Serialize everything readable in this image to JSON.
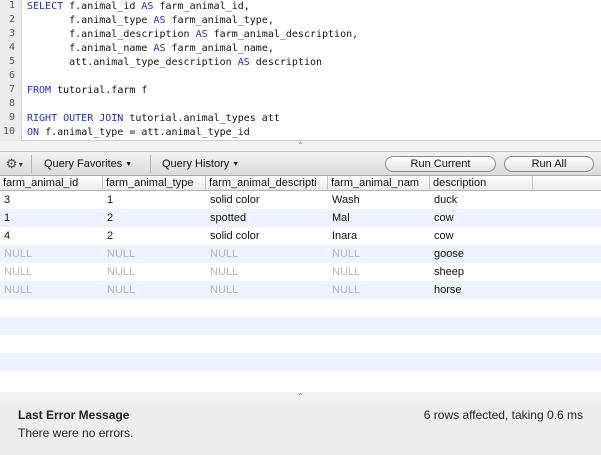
{
  "editor": {
    "lines": [
      {
        "number": "1",
        "segments": [
          {
            "t": "SELECT",
            "kw": true
          },
          {
            "t": " f.animal_id ",
            "kw": false
          },
          {
            "t": "AS",
            "kw": true
          },
          {
            "t": " farm_animal_id,",
            "kw": false
          }
        ]
      },
      {
        "number": "2",
        "segments": [
          {
            "t": "       f.animal_type ",
            "kw": false
          },
          {
            "t": "AS",
            "kw": true
          },
          {
            "t": " farm_animal_type,",
            "kw": false
          }
        ]
      },
      {
        "number": "3",
        "segments": [
          {
            "t": "       f.animal_description ",
            "kw": false
          },
          {
            "t": "AS",
            "kw": true
          },
          {
            "t": " farm_animal_description,",
            "kw": false
          }
        ]
      },
      {
        "number": "4",
        "segments": [
          {
            "t": "       f.animal_name ",
            "kw": false
          },
          {
            "t": "AS",
            "kw": true
          },
          {
            "t": " farm_animal_name,",
            "kw": false
          }
        ]
      },
      {
        "number": "5",
        "segments": [
          {
            "t": "       att.animal_type_description ",
            "kw": false
          },
          {
            "t": "AS",
            "kw": true
          },
          {
            "t": " description",
            "kw": false
          }
        ]
      },
      {
        "number": "6",
        "segments": []
      },
      {
        "number": "7",
        "segments": [
          {
            "t": "FROM",
            "kw": true
          },
          {
            "t": " tutorial.farm f",
            "kw": false
          }
        ]
      },
      {
        "number": "8",
        "segments": []
      },
      {
        "number": "9",
        "segments": [
          {
            "t": "RIGHT OUTER JOIN",
            "kw": true
          },
          {
            "t": " tutorial.animal_types att",
            "kw": false
          }
        ]
      },
      {
        "number": "10",
        "segments": [
          {
            "t": "ON",
            "kw": true
          },
          {
            "t": " f.animal_type = att.animal_type_id",
            "kw": false
          }
        ]
      }
    ]
  },
  "toolbar": {
    "gear_glyph": "⚙",
    "favorites_label": "Query Favorites",
    "history_label": "Query History",
    "run_current_label": "Run Current",
    "run_all_label": "Run All"
  },
  "grip_glyph": "⌃",
  "results": {
    "columns": [
      "farm_animal_id",
      "farm_animal_type",
      "farm_animal_descripti",
      "farm_animal_nam",
      "description"
    ],
    "rows": [
      [
        "3",
        "1",
        "solid color",
        "Wash",
        "duck"
      ],
      [
        "1",
        "2",
        "spotted",
        "Mal",
        "cow"
      ],
      [
        "4",
        "2",
        "solid color",
        "Inara",
        "cow"
      ],
      [
        "NULL",
        "NULL",
        "NULL",
        "NULL",
        "goose"
      ],
      [
        "NULL",
        "NULL",
        "NULL",
        "NULL",
        "sheep"
      ],
      [
        "NULL",
        "NULL",
        "NULL",
        "NULL",
        "horse"
      ]
    ],
    "null_text": "NULL",
    "stripe_color": "#edf3fe"
  },
  "status": {
    "error_title": "Last Error Message",
    "error_message": "There were no errors.",
    "rows_affected": "6 rows affected, taking 0.6 ms"
  },
  "colors": {
    "keyword": "#1c2bd9",
    "null": "#b5b5b5"
  }
}
